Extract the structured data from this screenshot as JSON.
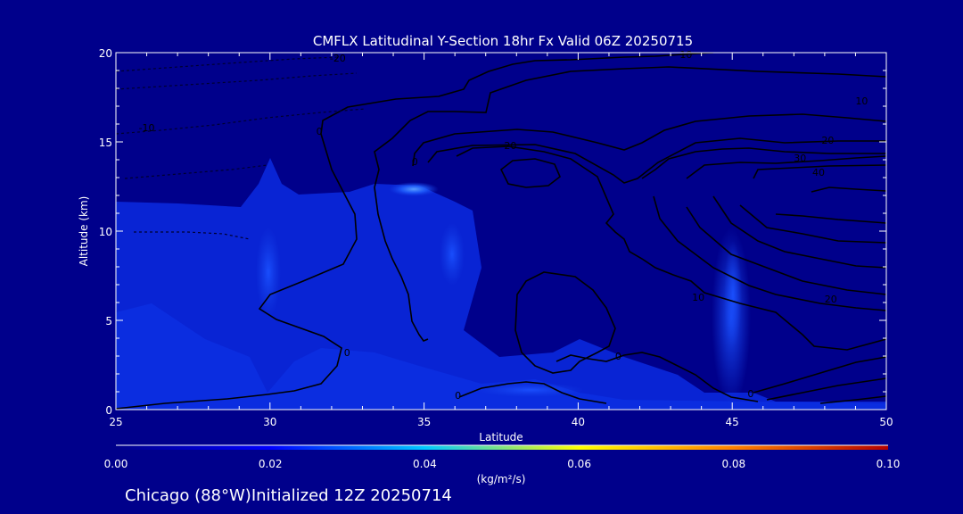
{
  "chart_data": {
    "type": "heatmap",
    "title": "CMFLX Latitudinal Y-Section 18hr  Fx Valid 06Z 20250715",
    "xlabel": "Latitude",
    "ylabel": "Altitude (km)",
    "xlim": [
      25,
      50
    ],
    "ylim": [
      0,
      20
    ],
    "x_ticks": [
      25,
      30,
      35,
      40,
      45,
      50
    ],
    "y_ticks": [
      0,
      5,
      10,
      15,
      20
    ],
    "colorbar": {
      "label": "(kg/m²/s)",
      "range": [
        0.0,
        0.1
      ],
      "ticks": [
        "0.00",
        "0.02",
        "0.04",
        "0.06",
        "0.08",
        "0.10"
      ],
      "colors": [
        "#00008b",
        "#0000ff",
        "#00c8ff",
        "#ffff00",
        "#ff8000",
        "#b40000"
      ]
    },
    "contour_labels": [
      {
        "value": "-20",
        "lat": 32.2,
        "alt": 19.7
      },
      {
        "value": "-10",
        "lat": 26.0,
        "alt": 15.8
      },
      {
        "value": "0",
        "lat": 31.6,
        "alt": 15.6
      },
      {
        "value": "0",
        "lat": 34.7,
        "alt": 13.9
      },
      {
        "value": "0",
        "lat": 32.5,
        "alt": 3.2
      },
      {
        "value": "0",
        "lat": 41.3,
        "alt": 3.0
      },
      {
        "value": "0",
        "lat": 36.1,
        "alt": 0.8
      },
      {
        "value": "0",
        "lat": 45.6,
        "alt": 0.9
      },
      {
        "value": "10",
        "lat": 43.5,
        "alt": 19.9
      },
      {
        "value": "10",
        "lat": 49.2,
        "alt": 17.3
      },
      {
        "value": "10",
        "lat": 43.9,
        "alt": 6.3
      },
      {
        "value": "20",
        "lat": 37.8,
        "alt": 14.8
      },
      {
        "value": "20",
        "lat": 48.1,
        "alt": 15.1
      },
      {
        "value": "20",
        "lat": 48.2,
        "alt": 6.2
      },
      {
        "value": "30",
        "lat": 47.2,
        "alt": 14.1
      },
      {
        "value": "40",
        "lat": 47.8,
        "alt": 13.3
      }
    ]
  },
  "footer": {
    "location": "Chicago (88°W)",
    "initialized": "Initialized 12Z 20250714"
  },
  "colors": {
    "background": "#00008b",
    "field": "#0a28dc",
    "contour": "#000000"
  }
}
